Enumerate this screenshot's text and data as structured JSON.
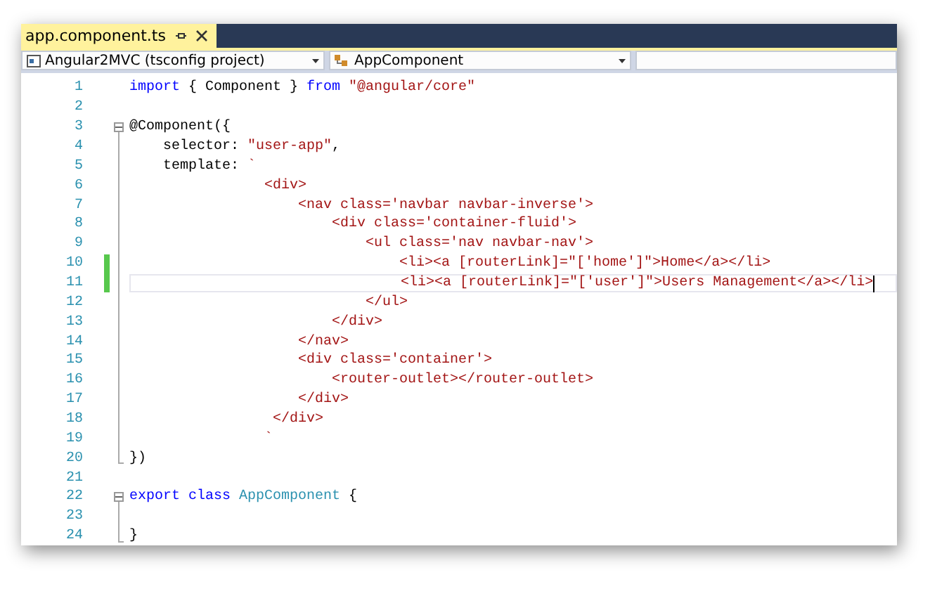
{
  "tab": {
    "title": "app.component.ts",
    "selected": true
  },
  "navigation_bar": {
    "project": "Angular2MVC (tsconfig project)",
    "member": "AppComponent"
  },
  "editor": {
    "lines": [
      {
        "number": "1",
        "changed": false,
        "current": false,
        "caret": false,
        "fold_start": false,
        "fold_end": false,
        "tokens": [
          {
            "kind": "keyword",
            "text": "import"
          },
          {
            "kind": "text",
            "text": " { Component } "
          },
          {
            "kind": "keyword",
            "text": "from"
          },
          {
            "kind": "string",
            "text": " \"@angular/core\""
          }
        ]
      },
      {
        "number": "2",
        "changed": false,
        "current": false,
        "caret": false,
        "fold_start": false,
        "fold_end": false
      },
      {
        "number": "3",
        "changed": false,
        "current": false,
        "caret": false,
        "fold_start": true,
        "fold_end": false,
        "tokens": [
          {
            "kind": "text",
            "text": "@Component({"
          }
        ]
      },
      {
        "number": "4",
        "changed": false,
        "current": false,
        "caret": false,
        "fold_start": false,
        "fold_end": false,
        "tokens": [
          {
            "kind": "text",
            "text": "    selector: "
          },
          {
            "kind": "string",
            "text": "\"user-app\""
          },
          {
            "kind": "text",
            "text": ","
          }
        ]
      },
      {
        "number": "5",
        "changed": false,
        "current": false,
        "caret": false,
        "fold_start": false,
        "fold_end": false,
        "tokens": [
          {
            "kind": "text",
            "text": "    template: "
          },
          {
            "kind": "string",
            "text": "`"
          }
        ]
      },
      {
        "number": "6",
        "changed": false,
        "current": false,
        "caret": false,
        "fold_start": false,
        "fold_end": false,
        "tokens": [
          {
            "kind": "string",
            "text": "                <div>"
          }
        ]
      },
      {
        "number": "7",
        "changed": false,
        "current": false,
        "caret": false,
        "fold_start": false,
        "fold_end": false,
        "tokens": [
          {
            "kind": "string",
            "text": "                    <nav class='navbar navbar-inverse'>"
          }
        ]
      },
      {
        "number": "8",
        "changed": false,
        "current": false,
        "caret": false,
        "fold_start": false,
        "fold_end": false,
        "tokens": [
          {
            "kind": "string",
            "text": "                        <div class='container-fluid'>"
          }
        ]
      },
      {
        "number": "9",
        "changed": false,
        "current": false,
        "caret": false,
        "fold_start": false,
        "fold_end": false,
        "tokens": [
          {
            "kind": "string",
            "text": "                            <ul class='nav navbar-nav'>"
          }
        ]
      },
      {
        "number": "10",
        "changed": true,
        "current": false,
        "caret": false,
        "fold_start": false,
        "fold_end": false,
        "tokens": [
          {
            "kind": "string",
            "text": "                                <li><a [routerLink]=\"['home']\">Home</a></li>"
          }
        ]
      },
      {
        "number": "11",
        "changed": true,
        "current": true,
        "caret": true,
        "fold_start": false,
        "fold_end": false,
        "tokens": [
          {
            "kind": "string",
            "text": "                                <li><a [routerLink]=\"['user']\">Users Management</a></li>"
          }
        ]
      },
      {
        "number": "12",
        "changed": false,
        "current": false,
        "caret": false,
        "fold_start": false,
        "fold_end": false,
        "tokens": [
          {
            "kind": "string",
            "text": "                            </ul>"
          }
        ]
      },
      {
        "number": "13",
        "changed": false,
        "current": false,
        "caret": false,
        "fold_start": false,
        "fold_end": false,
        "tokens": [
          {
            "kind": "string",
            "text": "                        </div>"
          }
        ]
      },
      {
        "number": "14",
        "changed": false,
        "current": false,
        "caret": false,
        "fold_start": false,
        "fold_end": false,
        "tokens": [
          {
            "kind": "string",
            "text": "                    </nav>"
          }
        ]
      },
      {
        "number": "15",
        "changed": false,
        "current": false,
        "caret": false,
        "fold_start": false,
        "fold_end": false,
        "tokens": [
          {
            "kind": "string",
            "text": "                    <div class='container'>"
          }
        ]
      },
      {
        "number": "16",
        "changed": false,
        "current": false,
        "caret": false,
        "fold_start": false,
        "fold_end": false,
        "tokens": [
          {
            "kind": "string",
            "text": "                        <router-outlet></router-outlet>"
          }
        ]
      },
      {
        "number": "17",
        "changed": false,
        "current": false,
        "caret": false,
        "fold_start": false,
        "fold_end": false,
        "tokens": [
          {
            "kind": "string",
            "text": "                    </div>"
          }
        ]
      },
      {
        "number": "18",
        "changed": false,
        "current": false,
        "caret": false,
        "fold_start": false,
        "fold_end": false,
        "tokens": [
          {
            "kind": "string",
            "text": "                 </div>"
          }
        ]
      },
      {
        "number": "19",
        "changed": false,
        "current": false,
        "caret": false,
        "fold_start": false,
        "fold_end": false,
        "tokens": [
          {
            "kind": "string",
            "text": "                `"
          }
        ]
      },
      {
        "number": "20",
        "changed": false,
        "current": false,
        "caret": false,
        "fold_start": false,
        "fold_end": true,
        "tokens": [
          {
            "kind": "text",
            "text": "})"
          }
        ]
      },
      {
        "number": "21",
        "changed": false,
        "current": false,
        "caret": false,
        "fold_start": false,
        "fold_end": false
      },
      {
        "number": "22",
        "changed": false,
        "current": false,
        "caret": false,
        "fold_start": true,
        "fold_end": false,
        "tokens": [
          {
            "kind": "keyword",
            "text": "export"
          },
          {
            "kind": "keyword",
            "text": " class"
          },
          {
            "kind": "type",
            "text": " AppComponent"
          },
          {
            "kind": "text",
            "text": " {"
          }
        ]
      },
      {
        "number": "23",
        "changed": false,
        "current": false,
        "caret": false,
        "fold_start": false,
        "fold_end": false
      },
      {
        "number": "24",
        "changed": false,
        "current": false,
        "caret": false,
        "fold_start": false,
        "fold_end": true,
        "tokens": [
          {
            "kind": "text",
            "text": "}"
          }
        ]
      }
    ]
  }
}
